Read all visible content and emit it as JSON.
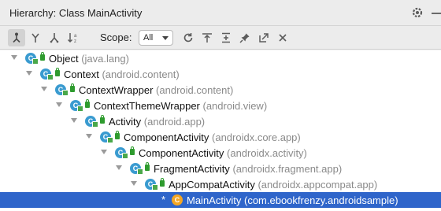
{
  "window": {
    "title": "Hierarchy: Class MainActivity",
    "gear_icon": "gear-icon",
    "minimize_icon": "minimize-icon"
  },
  "toolbar": {
    "scope_label": "Scope:",
    "scope_value": "All",
    "buttons": [
      "type-hierarchy-icon",
      "supertypes-icon",
      "subtypes-icon",
      "sort-alphabetically-icon",
      "refresh-icon",
      "autoscroll-to-source-icon",
      "expand-all-icon",
      "pin-icon",
      "export-icon",
      "close-icon"
    ]
  },
  "tree": [
    {
      "name": "Object",
      "pkg": "(java.lang)"
    },
    {
      "name": "Context",
      "pkg": "(android.content)"
    },
    {
      "name": "ContextWrapper",
      "pkg": "(android.content)"
    },
    {
      "name": "ContextThemeWrapper",
      "pkg": "(android.view)"
    },
    {
      "name": "Activity",
      "pkg": "(android.app)"
    },
    {
      "name": "ComponentActivity",
      "pkg": "(androidx.core.app)"
    },
    {
      "name": "ComponentActivity",
      "pkg": "(androidx.activity)"
    },
    {
      "name": "FragmentActivity",
      "pkg": "(androidx.fragment.app)"
    },
    {
      "name": "AppCompatActivity",
      "pkg": "(androidx.appcompat.app)"
    },
    {
      "name": "MainActivity",
      "pkg": "(com.ebookfrenzy.androidsample)",
      "marker": "*",
      "selected": true
    }
  ],
  "colors": {
    "selection": "#2f65ca",
    "class_icon": "#3a9bd0",
    "package_text": "#8a8a8a"
  }
}
